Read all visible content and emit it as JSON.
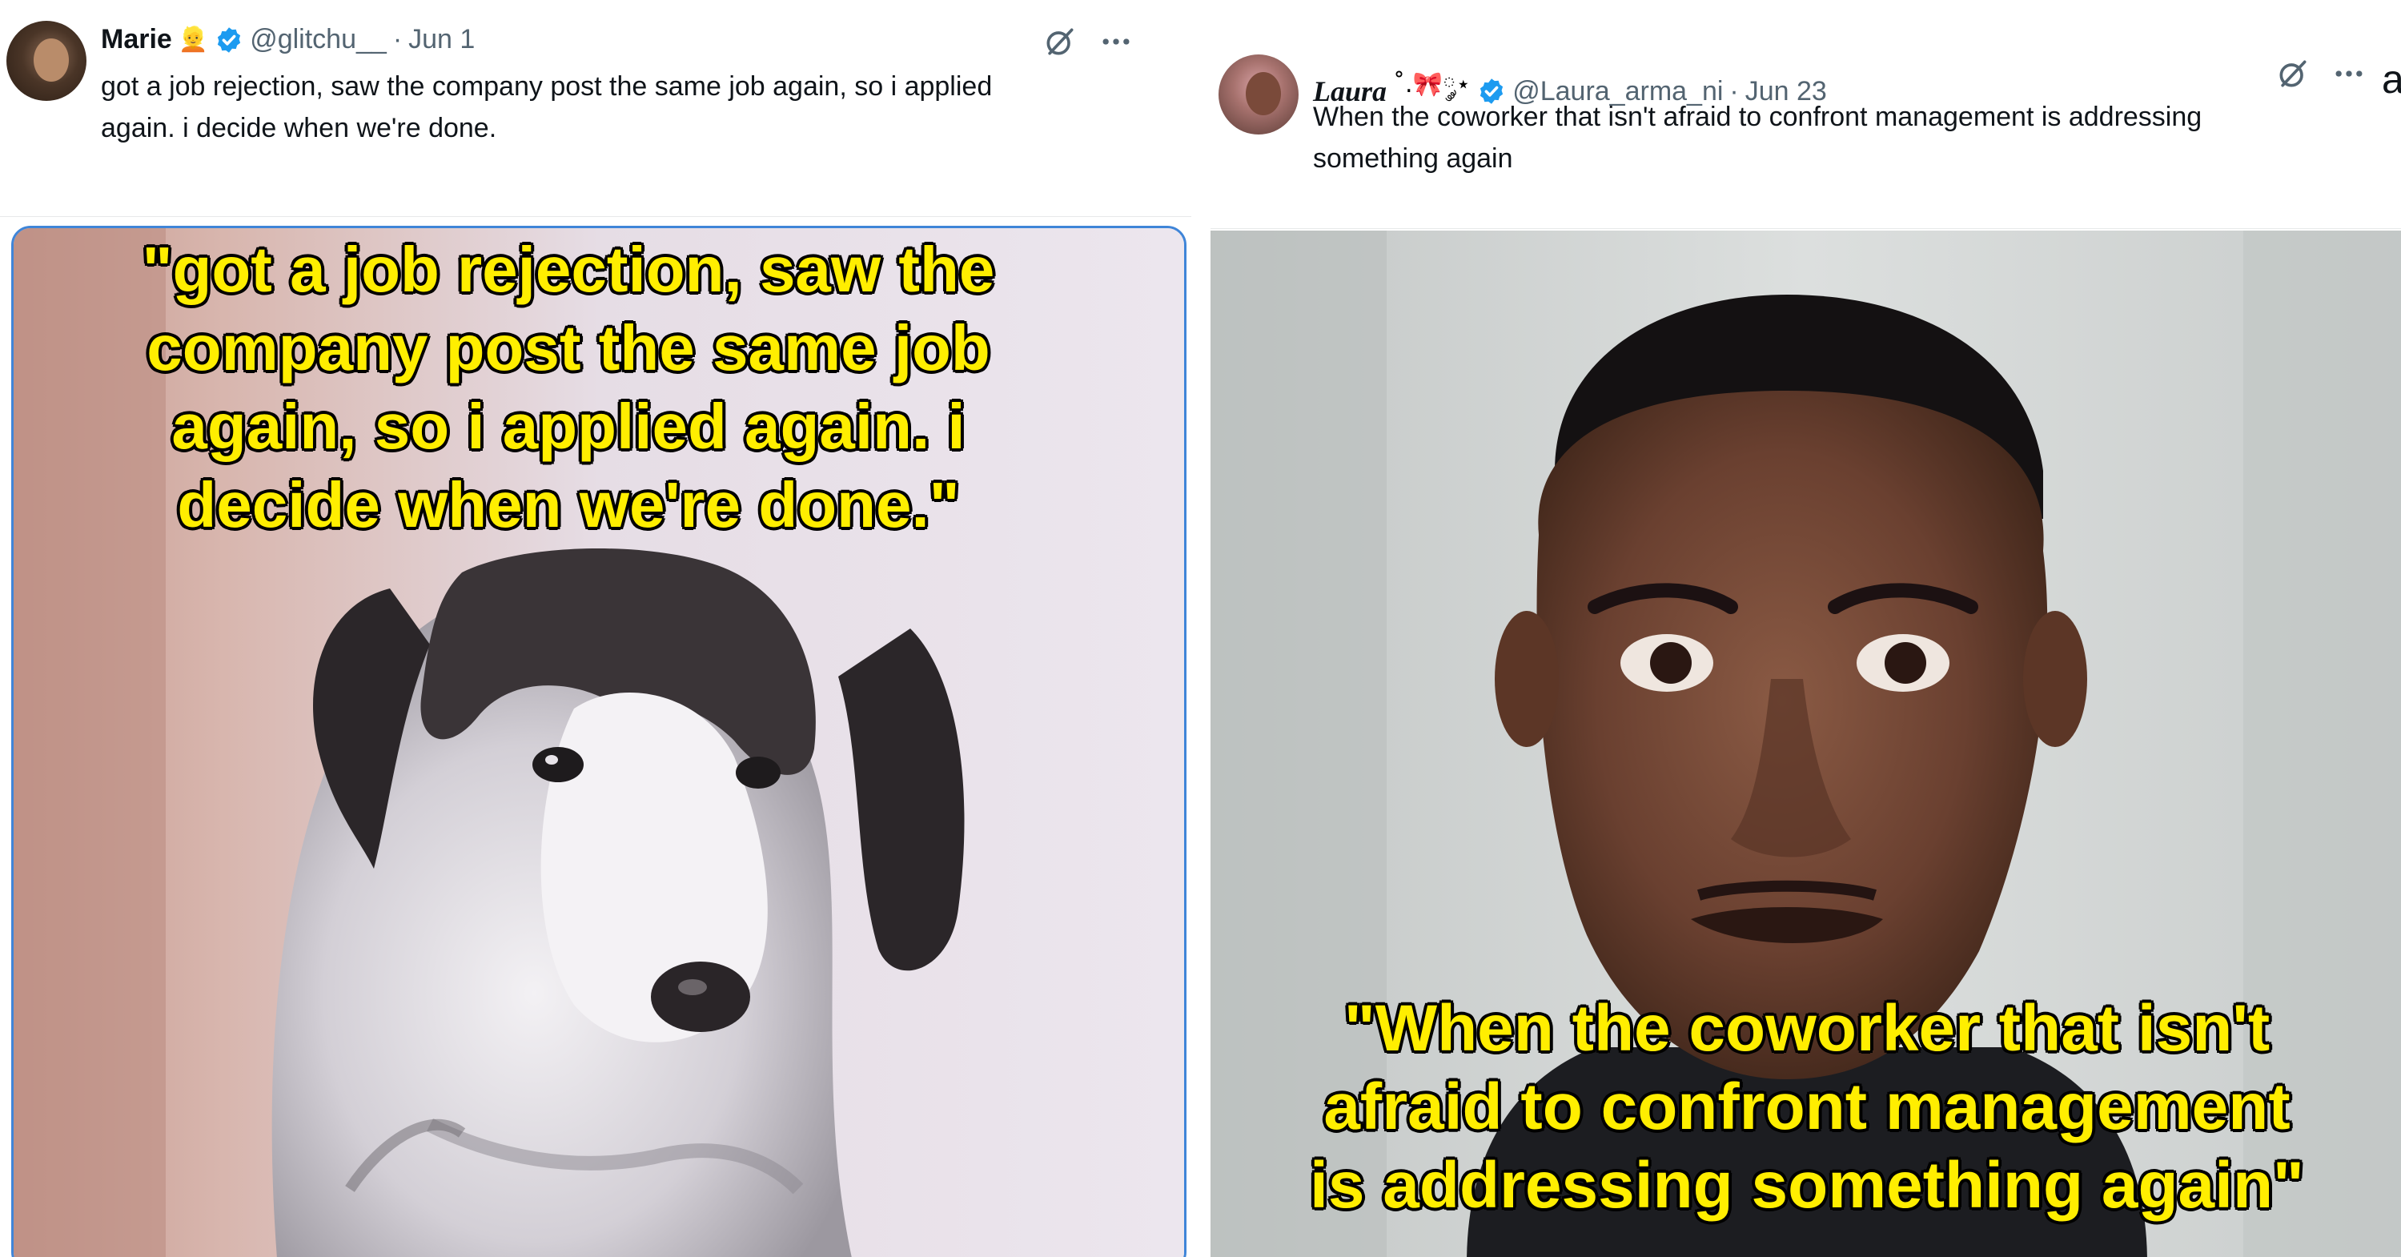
{
  "colors": {
    "caption_fill": "#ffee00",
    "caption_stroke": "#000000",
    "verified": "#1d9bf0",
    "text_secondary": "#536471",
    "text_primary": "#0f1419",
    "media_border": "#3f85d8"
  },
  "left_tweet": {
    "display_name": "Marie",
    "name_emoji": "👱",
    "handle": "@glitchu__",
    "separator": "·",
    "date": "Jun 1",
    "text_line1": "got a job rejection, saw the company post the same job again, so i applied",
    "text_line2": "again. i decide when we're done.",
    "caption": "\"got a job rejection, saw the\ncompany post the same job\nagain, so i applied again. i\ndecide when we're done.\"",
    "icons": [
      "avatar",
      "verified-badge-icon",
      "grok-icon",
      "more-icon"
    ]
  },
  "right_tweet": {
    "display_name": "Laura",
    "name_suffix": "˚.🎀༘⋆",
    "handle": "@Laura_arma_ni",
    "separator": "·",
    "date": "Jun 23",
    "text_line1": "When the coworker that isn't afraid to confront management is addressing",
    "text_line2": "something again",
    "caption": "\"When the coworker that isn't\nafraid to confront management\nis addressing something again\"",
    "cut_letter": "a",
    "icons": [
      "avatar",
      "verified-badge-icon",
      "grok-icon",
      "more-icon"
    ]
  }
}
